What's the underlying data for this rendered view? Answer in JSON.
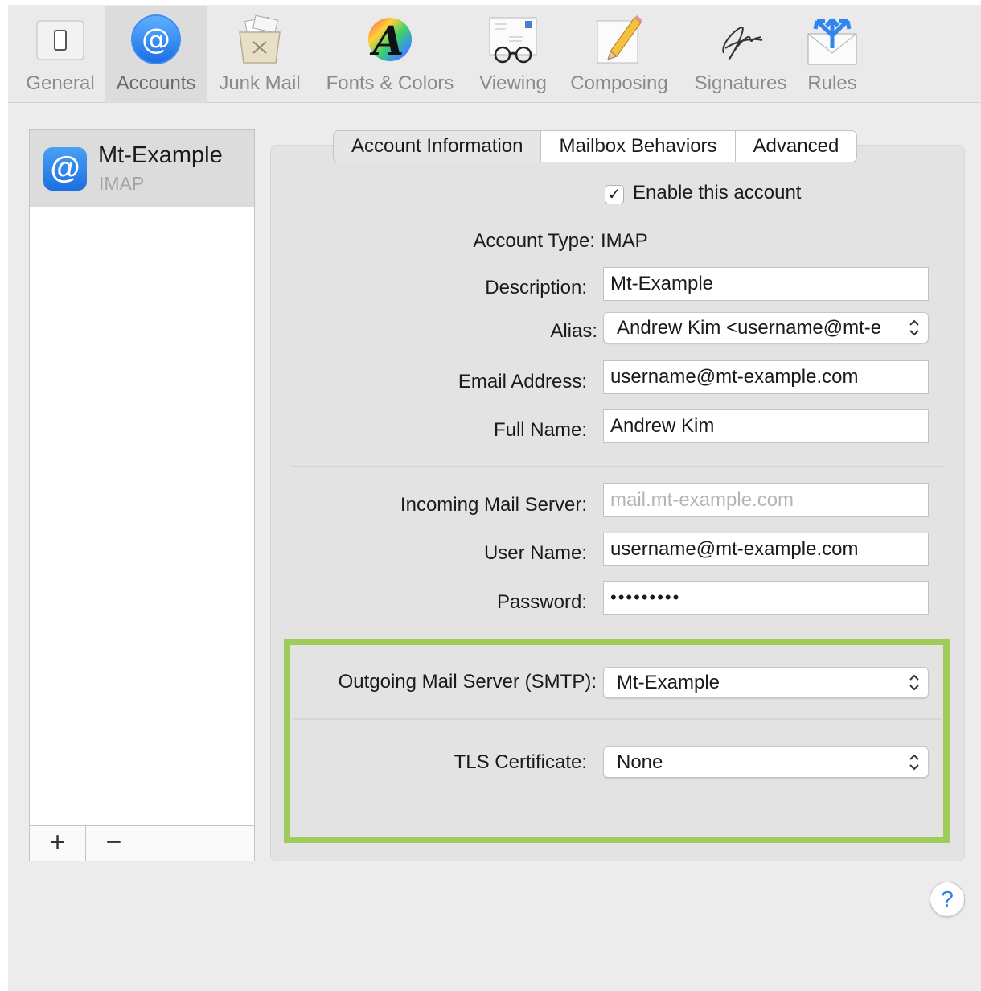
{
  "toolbar": {
    "items": [
      {
        "label": "General",
        "icon": "general-switch-icon"
      },
      {
        "label": "Accounts",
        "icon": "at-sign-icon"
      },
      {
        "label": "Junk Mail",
        "icon": "junk-trash-icon"
      },
      {
        "label": "Fonts & Colors",
        "icon": "font-color-icon"
      },
      {
        "label": "Viewing",
        "icon": "glasses-icon"
      },
      {
        "label": "Composing",
        "icon": "pencil-icon"
      },
      {
        "label": "Signatures",
        "icon": "signature-icon"
      },
      {
        "label": "Rules",
        "icon": "rules-envelope-icon"
      }
    ],
    "selected": "Accounts"
  },
  "accounts": {
    "items": [
      {
        "name": "Mt-Example",
        "type": "IMAP"
      }
    ],
    "add_label": "+",
    "remove_label": "−"
  },
  "tabs": [
    "Account Information",
    "Mailbox Behaviors",
    "Advanced"
  ],
  "form": {
    "enable_label": "Enable this account",
    "enable_checked": "✓",
    "account_type_label": "Account Type:",
    "account_type_value": "IMAP",
    "description_label": "Description:",
    "description_value": "Mt-Example",
    "alias_label": "Alias:",
    "alias_value": "Andrew Kim <username@mt-e",
    "email_label": "Email Address:",
    "email_value": "username@mt-example.com",
    "fullname_label": "Full Name:",
    "fullname_value": "Andrew Kim",
    "incoming_label": "Incoming Mail Server:",
    "incoming_placeholder": "mail.mt-example.com",
    "username_label": "User Name:",
    "username_value": "username@mt-example.com",
    "password_label": "Password:",
    "password_value": "•••••••••",
    "smtp_label": "Outgoing Mail Server (SMTP):",
    "smtp_value": "Mt-Example",
    "tls_label": "TLS Certificate:",
    "tls_value": "None"
  },
  "help_label": "?",
  "colors": {
    "highlight": "#9fcb5a",
    "accent": "#2d7ff0"
  }
}
